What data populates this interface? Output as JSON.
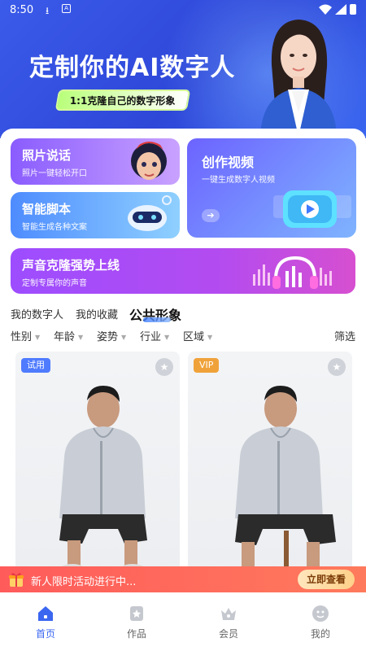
{
  "status": {
    "time": "8:50"
  },
  "hero": {
    "title": "定制你的AI数字人",
    "subtitle": "1:1克隆自己的数字形象"
  },
  "features": {
    "photo": {
      "title": "照片说话",
      "sub": "照片一键轻松开口"
    },
    "script": {
      "title": "智能脚本",
      "sub": "智能生成各种文案"
    },
    "video": {
      "title": "创作视频",
      "sub": "一键生成数字人视频"
    },
    "voice": {
      "title": "声音克隆强势上线",
      "sub": "定制专属你的声音"
    }
  },
  "tabs": [
    "我的数字人",
    "我的收藏",
    "公共形象"
  ],
  "filters": [
    "性别",
    "年龄",
    "姿势",
    "行业",
    "区域"
  ],
  "filter_right": "筛选",
  "grid": [
    {
      "badge": "试用",
      "badge_color": "#4f7bff"
    },
    {
      "badge": "VIP",
      "badge_color": "#f0a23a"
    }
  ],
  "promo": {
    "text": "新人限时活动进行中...",
    "button": "立即查看"
  },
  "nav": [
    {
      "label": "首页",
      "icon": "home-icon",
      "active": true
    },
    {
      "label": "作品",
      "icon": "works-icon",
      "active": false
    },
    {
      "label": "会员",
      "icon": "crown-icon",
      "active": false
    },
    {
      "label": "我的",
      "icon": "profile-icon",
      "active": false
    }
  ],
  "colors": {
    "accent": "#3a66f0",
    "promo": "#ff5b5b"
  }
}
